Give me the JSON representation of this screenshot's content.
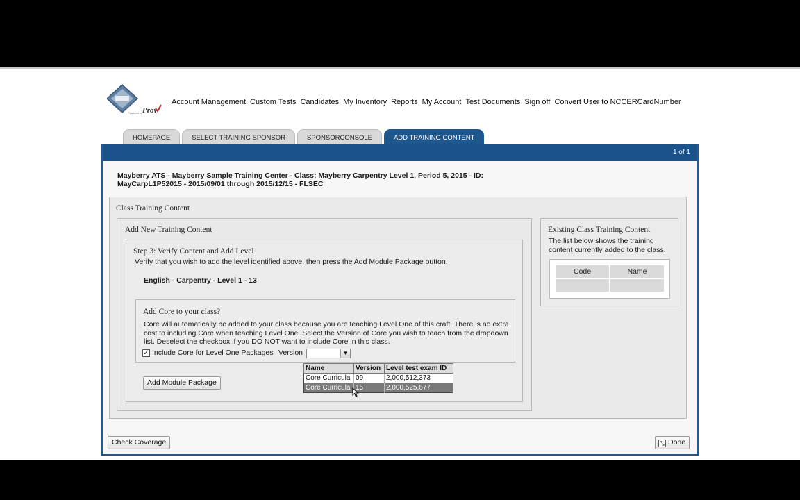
{
  "brand": {
    "powered_by": "Powered by",
    "logo_text": "Prov"
  },
  "nav": [
    "Account Management",
    "Custom Tests",
    "Candidates",
    "My Inventory",
    "Reports",
    "My Account",
    "Test Documents",
    "Sign off",
    "Convert User to NCCERCardNumber"
  ],
  "tabs": [
    {
      "label": "HOMEPAGE",
      "active": false
    },
    {
      "label": "SELECT TRAINING SPONSOR",
      "active": false
    },
    {
      "label": "SPONSORCONSOLE",
      "active": false
    },
    {
      "label": "ADD TRAINING CONTENT",
      "active": true
    }
  ],
  "panel": {
    "page_indicator": "1 of 1",
    "class_info_line1": "Mayberry ATS - Mayberry Sample Training Center - Class: Mayberry Carpentry Level 1, Period 5, 2015 - ID:",
    "class_info_line2": "MayCarpL1P52015 - 2015/09/01 through 2015/12/15 - FLSEC"
  },
  "class_training_content": {
    "title": "Class Training Content",
    "add_new": {
      "title": "Add New Training Content",
      "step_title": "Step 3: Verify Content and Add Level",
      "step_desc": "Verify that you wish to add the level identified above, then press the Add Module Package button.",
      "level_name": "English - Carpentry - Level 1 - 13",
      "core": {
        "title": "Add Core to your class?",
        "desc_line1": "Core will automatically be added to your class because you are teaching Level One of this craft. There is no extra",
        "desc_line2": "cost to including Core when teaching Level One. Select the Version of Core you wish to teach from the dropdown",
        "desc_line3": "list. Deselect the checkbox if you DO NOT want to include Core in this class.",
        "checkbox_label": "Include Core for Level One Packages",
        "checkbox_checked": true,
        "version_label": "Version",
        "version_value": "",
        "dropdown": {
          "headers": [
            "Name",
            "Version",
            "Level test exam ID"
          ],
          "rows": [
            [
              "Core Curricula",
              "09",
              "2,000,512,373"
            ],
            [
              "Core Curricula",
              "15",
              "2,000,525,677"
            ]
          ],
          "highlighted_row": 1
        }
      },
      "add_button": "Add Module Package"
    },
    "existing": {
      "title": "Existing Class Training Content",
      "desc_line1": "The list below shows the training",
      "desc_line2": "content currently added to the class.",
      "headers": [
        "Code",
        "Name"
      ]
    }
  },
  "footer": {
    "check_coverage": "Check Coverage",
    "done": "Done"
  },
  "colors": {
    "header_blue": "#1c528a",
    "tab_inactive": "#d9d9d9",
    "highlight_row": "#7a7a7a"
  }
}
